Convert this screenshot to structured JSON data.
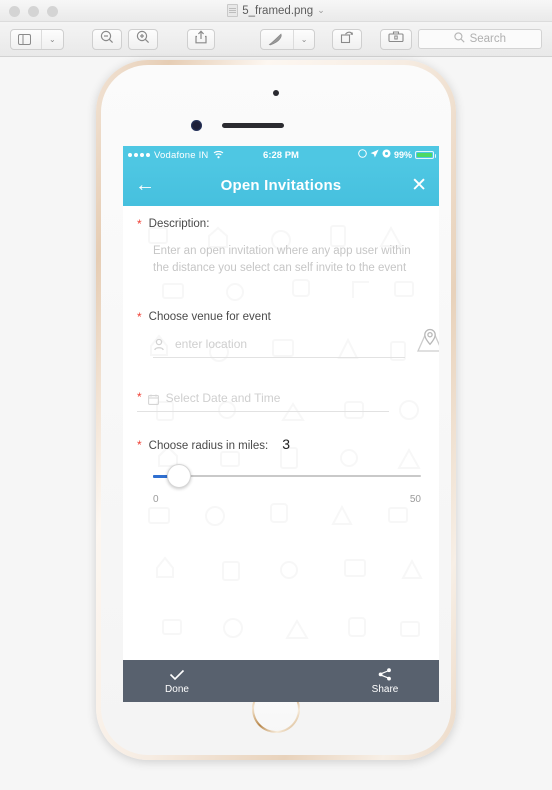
{
  "window": {
    "document_title": "5_framed.png",
    "title_chevron": "⌄",
    "traffic_lights": [
      "close",
      "minimize",
      "zoom"
    ],
    "toolbar": {
      "sidebar_button": "sidebar-view",
      "sidebar_chevron": "⌄",
      "zoom_out": "⊖",
      "zoom_in": "⊕",
      "share": "share",
      "markup": "markup-pen",
      "markup_chevron": "⌄",
      "rotate": "rotate",
      "toolkit": "toolkit",
      "search_placeholder": "Search",
      "search_icon": "search-icon"
    }
  },
  "phone": {
    "statusbar": {
      "signal_dots": 4,
      "carrier": "Vodafone IN",
      "wifi_icon": "wifi-icon",
      "time": "6:28 PM",
      "do_not_disturb_icon": "moon-icon",
      "location_icon": "location-arrow-icon",
      "rotation_lock_icon": "rotation-lock-icon",
      "battery_percent": "99%",
      "battery_color": "#4cd964"
    },
    "navbar": {
      "back_icon": "←",
      "title": "Open Invitations",
      "close_icon": "✕",
      "background_color": "#4ec7e3"
    },
    "form": {
      "required_marker": "*",
      "required_color": "#ef4136",
      "description_label": "Description:",
      "description_placeholder": "Enter an open invitation where any app user within the distance you select can self invite to the event",
      "venue_label": "Choose venue for event",
      "venue_placeholder": "enter location",
      "venue_pin_icon": "map-pin-icon",
      "venue_map_icon": "map-marker-icon",
      "datetime_placeholder": "Select Date and Time",
      "datetime_icon": "calendar-icon",
      "radius_label": "Choose radius in miles:",
      "radius_value": "3",
      "slider_min": "0",
      "slider_max": "50",
      "slider_fill_color": "#2f6fd0"
    },
    "bottombar": {
      "background_color": "#58616e",
      "done_label": "Done",
      "done_icon": "check-icon",
      "share_label": "Share",
      "share_icon": "share-icon"
    }
  }
}
